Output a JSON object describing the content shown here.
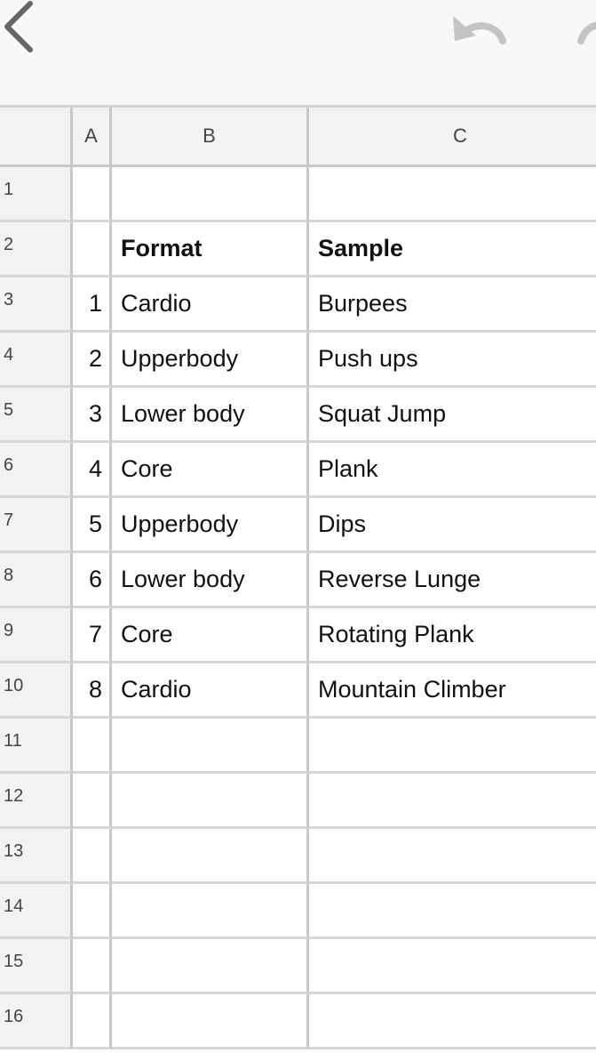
{
  "toolbar": {
    "back_icon": "chevron-left-icon",
    "undo_icon": "undo-icon",
    "redo_icon": "redo-icon"
  },
  "columns": [
    "A",
    "B",
    "C"
  ],
  "rows": [
    {
      "num": "1",
      "a": "",
      "b": "",
      "c": ""
    },
    {
      "num": "2",
      "a": "",
      "b": "Format",
      "c": "Sample"
    },
    {
      "num": "3",
      "a": "1",
      "b": "Cardio",
      "c": "Burpees"
    },
    {
      "num": "4",
      "a": "2",
      "b": "Upperbody",
      "c": "Push ups"
    },
    {
      "num": "5",
      "a": "3",
      "b": "Lower body",
      "c": "Squat Jump"
    },
    {
      "num": "6",
      "a": "4",
      "b": "Core",
      "c": "Plank"
    },
    {
      "num": "7",
      "a": "5",
      "b": "Upperbody",
      "c": "Dips"
    },
    {
      "num": "8",
      "a": "6",
      "b": "Lower body",
      "c": "Reverse Lunge"
    },
    {
      "num": "9",
      "a": "7",
      "b": "Core",
      "c": "Rotating Plank"
    },
    {
      "num": "10",
      "a": "8",
      "b": "Cardio",
      "c": "Mountain Climber"
    },
    {
      "num": "11",
      "a": "",
      "b": "",
      "c": ""
    },
    {
      "num": "12",
      "a": "",
      "b": "",
      "c": ""
    },
    {
      "num": "13",
      "a": "",
      "b": "",
      "c": ""
    },
    {
      "num": "14",
      "a": "",
      "b": "",
      "c": ""
    },
    {
      "num": "15",
      "a": "",
      "b": "",
      "c": ""
    },
    {
      "num": "16",
      "a": "",
      "b": "",
      "c": ""
    }
  ]
}
